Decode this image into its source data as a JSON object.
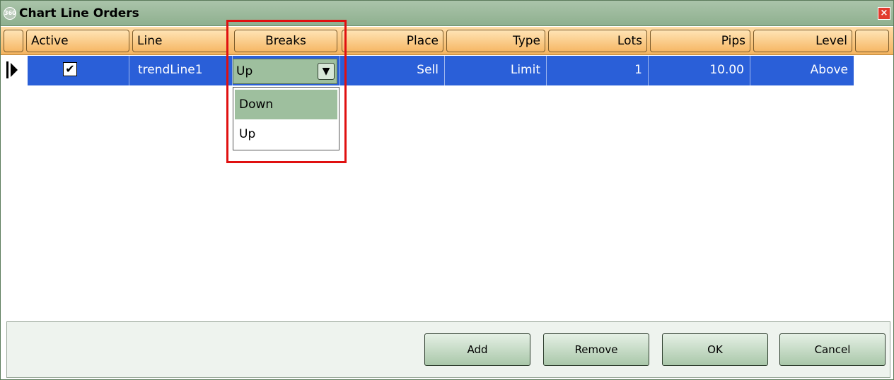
{
  "window": {
    "title": "Chart Line Orders",
    "badge": "360",
    "close_glyph": "×"
  },
  "columns": [
    "Active",
    "Line",
    "Breaks",
    "Place",
    "Type",
    "Lots",
    "Pips",
    "Level"
  ],
  "rows": [
    {
      "active": true,
      "line": "trendLine1",
      "breaks": "Up",
      "place": "Sell",
      "type": "Limit",
      "lots": "1",
      "pips": "10.00",
      "level": "Above"
    }
  ],
  "breaks_dropdown": {
    "toggle_glyph": "▼",
    "options": [
      "Down",
      "Up"
    ],
    "highlighted": "Down"
  },
  "check_glyph": "✔",
  "buttons": {
    "add": "Add",
    "remove": "Remove",
    "ok": "OK",
    "cancel": "Cancel"
  },
  "colors": {
    "title_bar": "#9fbc9f",
    "header": "#f6b765",
    "selected_row": "#2a5fd8",
    "highlight": "#e01010"
  },
  "icons": {
    "app": "app-360-icon",
    "close": "close-icon",
    "row_pointer": "row-pointer-icon",
    "dropdown": "chevron-down-icon",
    "check": "checkmark-icon"
  }
}
